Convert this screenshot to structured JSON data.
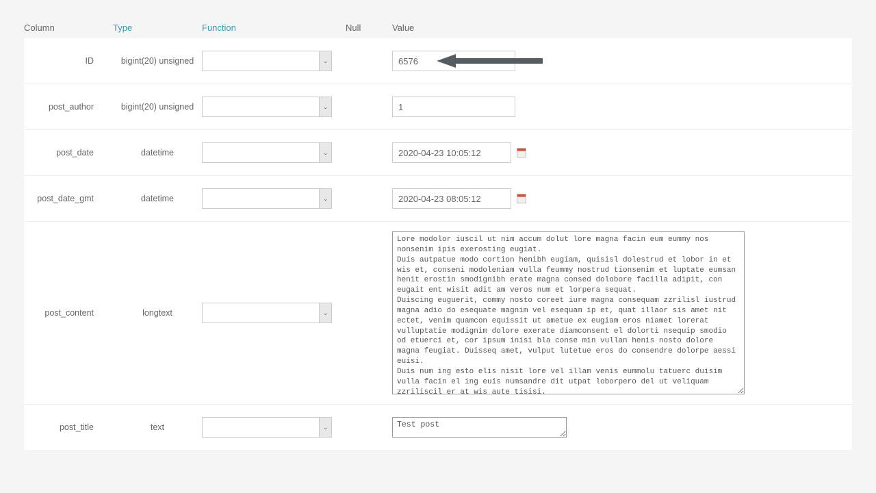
{
  "headers": {
    "column": "Column",
    "type": "Type",
    "function": "Function",
    "null": "Null",
    "value": "Value"
  },
  "rows": [
    {
      "column": "ID",
      "type": "bigint(20) unsigned",
      "value": "6576",
      "kind": "text",
      "has_cal": false,
      "has_arrow": true
    },
    {
      "column": "post_author",
      "type": "bigint(20) unsigned",
      "value": "1",
      "kind": "text",
      "has_cal": false
    },
    {
      "column": "post_date",
      "type": "datetime",
      "value": "2020-04-23 10:05:12",
      "kind": "text",
      "has_cal": true
    },
    {
      "column": "post_date_gmt",
      "type": "datetime",
      "value": "2020-04-23 08:05:12",
      "kind": "text",
      "has_cal": true
    },
    {
      "column": "post_content",
      "type": "longtext",
      "value": "Lore modolor iuscil ut nim accum dolut lore magna facin eum eummy nos nonsenim ipis exerosting eugiat.\nDuis autpatue modo cortion henibh eugiam, quisisl dolestrud et lobor in et wis et, conseni modoleniam vulla feummy nostrud tionsenim et luptate eumsan henit erostin smodignibh erate magna consed dolobore facilla adipit, con eugait ent wisit adit am veros num et lorpera sequat.\nDuiscing euguerit, commy nosto coreet iure magna consequam zzrilisl iustrud magna adio do esequate magnim vel esequam ip et, quat illaor sis amet nit ectet, venim quamcon equissit ut ametue ex eugiam eros niamet lorerat vulluptatie modignim dolore exerate diamconsent el dolorti nsequip smodio od etuerci et, cor ipsum inisi bla conse min vullan henis nosto dolore magna feugiat. Duisseq amet, vulput lutetue eros do consendre dolorpe aessi euisi.\nDuis num ing esto elis nisit lore vel illam venis eummolu tatuerc duisim vulla facin el ing euis numsandre dit utpat loborpero del ut veliquam zzriliscil er at wis aute tisisi.\nLore dunt lut lore feu feu facilis nissequat la facipisisit prat.",
      "kind": "textarea-large",
      "has_cal": false
    },
    {
      "column": "post_title",
      "type": "text",
      "value": "Test post",
      "kind": "textarea-small",
      "has_cal": false
    }
  ]
}
